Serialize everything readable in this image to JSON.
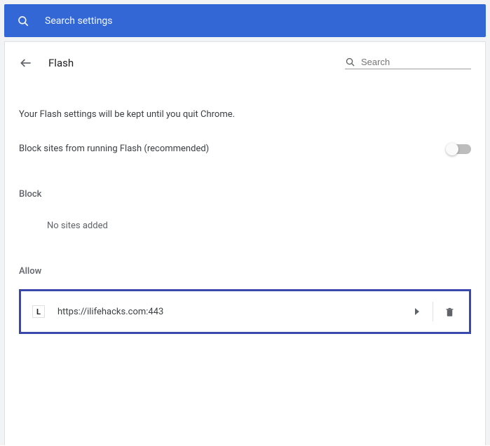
{
  "banner": {
    "placeholder": "Search settings"
  },
  "header": {
    "title": "Flash",
    "search_placeholder": "Search"
  },
  "info_text": "Your Flash settings will be kept until you quit Chrome.",
  "toggle": {
    "label": "Block sites from running Flash (recommended)",
    "state": "off"
  },
  "block_section": {
    "heading": "Block",
    "empty_text": "No sites added"
  },
  "allow_section": {
    "heading": "Allow",
    "sites": [
      {
        "favicon_letter": "L",
        "url": "https://ilifehacks.com:443"
      }
    ]
  }
}
